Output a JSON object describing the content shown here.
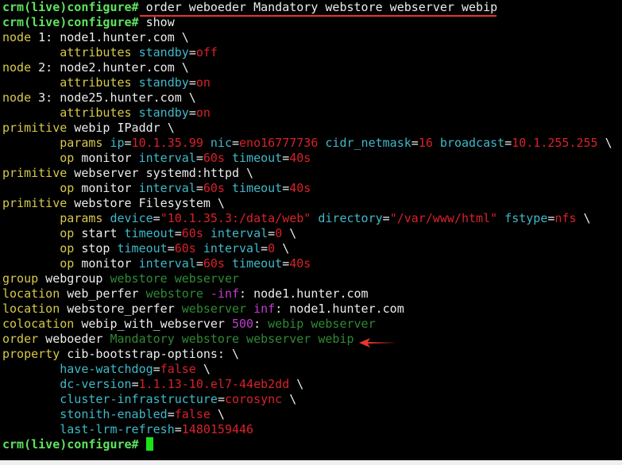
{
  "terminal": {
    "lines": [
      [
        {
          "t": "crm(live)configure# ",
          "c": "prompt"
        },
        {
          "t": "order weboeder Mandatory webstore webserver webip",
          "c": "cmd"
        }
      ],
      [
        {
          "t": "crm(live)configure# ",
          "c": "prompt"
        },
        {
          "t": "show",
          "c": "cmd"
        }
      ],
      [
        {
          "t": "node",
          "c": "kw"
        },
        {
          "t": " 1: node1.hunter.com \\",
          "c": "plain"
        }
      ],
      [
        {
          "t": "        ",
          "c": "plain"
        },
        {
          "t": "attributes",
          "c": "sub"
        },
        {
          "t": " ",
          "c": "plain"
        },
        {
          "t": "standby",
          "c": "attr"
        },
        {
          "t": "=",
          "c": "plain"
        },
        {
          "t": "off",
          "c": "val"
        }
      ],
      [
        {
          "t": "node",
          "c": "kw"
        },
        {
          "t": " 2: node2.hunter.com \\",
          "c": "plain"
        }
      ],
      [
        {
          "t": "        ",
          "c": "plain"
        },
        {
          "t": "attributes",
          "c": "sub"
        },
        {
          "t": " ",
          "c": "plain"
        },
        {
          "t": "standby",
          "c": "attr"
        },
        {
          "t": "=",
          "c": "plain"
        },
        {
          "t": "on",
          "c": "val"
        }
      ],
      [
        {
          "t": "node",
          "c": "kw"
        },
        {
          "t": " 3: node25.hunter.com \\",
          "c": "plain"
        }
      ],
      [
        {
          "t": "        ",
          "c": "plain"
        },
        {
          "t": "attributes",
          "c": "sub"
        },
        {
          "t": " ",
          "c": "plain"
        },
        {
          "t": "standby",
          "c": "attr"
        },
        {
          "t": "=",
          "c": "plain"
        },
        {
          "t": "on",
          "c": "val"
        }
      ],
      [
        {
          "t": "primitive",
          "c": "kw"
        },
        {
          "t": " webip IPaddr \\",
          "c": "plain"
        }
      ],
      [
        {
          "t": "        ",
          "c": "plain"
        },
        {
          "t": "params",
          "c": "sub"
        },
        {
          "t": " ",
          "c": "plain"
        },
        {
          "t": "ip",
          "c": "attr"
        },
        {
          "t": "=",
          "c": "plain"
        },
        {
          "t": "10.1.35.99",
          "c": "val"
        },
        {
          "t": " ",
          "c": "plain"
        },
        {
          "t": "nic",
          "c": "attr"
        },
        {
          "t": "=",
          "c": "plain"
        },
        {
          "t": "eno16777736",
          "c": "val"
        },
        {
          "t": " ",
          "c": "plain"
        },
        {
          "t": "cidr_netmask",
          "c": "attr"
        },
        {
          "t": "=",
          "c": "plain"
        },
        {
          "t": "16",
          "c": "val"
        },
        {
          "t": " ",
          "c": "plain"
        },
        {
          "t": "broadcast",
          "c": "attr"
        },
        {
          "t": "=",
          "c": "plain"
        },
        {
          "t": "10.1.255.255",
          "c": "val"
        },
        {
          "t": " \\",
          "c": "plain"
        }
      ],
      [
        {
          "t": "        ",
          "c": "plain"
        },
        {
          "t": "op",
          "c": "sub"
        },
        {
          "t": " monitor ",
          "c": "plain"
        },
        {
          "t": "interval",
          "c": "attr"
        },
        {
          "t": "=",
          "c": "plain"
        },
        {
          "t": "60s",
          "c": "val"
        },
        {
          "t": " ",
          "c": "plain"
        },
        {
          "t": "timeout",
          "c": "attr"
        },
        {
          "t": "=",
          "c": "plain"
        },
        {
          "t": "40s",
          "c": "val"
        }
      ],
      [
        {
          "t": "primitive",
          "c": "kw"
        },
        {
          "t": " webserver systemd:httpd \\",
          "c": "plain"
        }
      ],
      [
        {
          "t": "        ",
          "c": "plain"
        },
        {
          "t": "op",
          "c": "sub"
        },
        {
          "t": " monitor ",
          "c": "plain"
        },
        {
          "t": "interval",
          "c": "attr"
        },
        {
          "t": "=",
          "c": "plain"
        },
        {
          "t": "60s",
          "c": "val"
        },
        {
          "t": " ",
          "c": "plain"
        },
        {
          "t": "timeout",
          "c": "attr"
        },
        {
          "t": "=",
          "c": "plain"
        },
        {
          "t": "40s",
          "c": "val"
        }
      ],
      [
        {
          "t": "primitive",
          "c": "kw"
        },
        {
          "t": " webstore Filesystem \\",
          "c": "plain"
        }
      ],
      [
        {
          "t": "        ",
          "c": "plain"
        },
        {
          "t": "params",
          "c": "sub"
        },
        {
          "t": " ",
          "c": "plain"
        },
        {
          "t": "device",
          "c": "attr"
        },
        {
          "t": "=",
          "c": "plain"
        },
        {
          "t": "\"10.1.35.3:/data/web\"",
          "c": "val"
        },
        {
          "t": " ",
          "c": "plain"
        },
        {
          "t": "directory",
          "c": "attr"
        },
        {
          "t": "=",
          "c": "plain"
        },
        {
          "t": "\"/var/www/html\"",
          "c": "val"
        },
        {
          "t": " ",
          "c": "plain"
        },
        {
          "t": "fstype",
          "c": "attr"
        },
        {
          "t": "=",
          "c": "plain"
        },
        {
          "t": "nfs",
          "c": "val"
        },
        {
          "t": " \\",
          "c": "plain"
        }
      ],
      [
        {
          "t": "        ",
          "c": "plain"
        },
        {
          "t": "op",
          "c": "sub"
        },
        {
          "t": " start ",
          "c": "plain"
        },
        {
          "t": "timeout",
          "c": "attr"
        },
        {
          "t": "=",
          "c": "plain"
        },
        {
          "t": "60s",
          "c": "val"
        },
        {
          "t": " ",
          "c": "plain"
        },
        {
          "t": "interval",
          "c": "attr"
        },
        {
          "t": "=",
          "c": "plain"
        },
        {
          "t": "0",
          "c": "val"
        },
        {
          "t": " \\",
          "c": "plain"
        }
      ],
      [
        {
          "t": "        ",
          "c": "plain"
        },
        {
          "t": "op",
          "c": "sub"
        },
        {
          "t": " stop ",
          "c": "plain"
        },
        {
          "t": "timeout",
          "c": "attr"
        },
        {
          "t": "=",
          "c": "plain"
        },
        {
          "t": "60s",
          "c": "val"
        },
        {
          "t": " ",
          "c": "plain"
        },
        {
          "t": "interval",
          "c": "attr"
        },
        {
          "t": "=",
          "c": "plain"
        },
        {
          "t": "0",
          "c": "val"
        },
        {
          "t": " \\",
          "c": "plain"
        }
      ],
      [
        {
          "t": "        ",
          "c": "plain"
        },
        {
          "t": "op",
          "c": "sub"
        },
        {
          "t": " monitor ",
          "c": "plain"
        },
        {
          "t": "interval",
          "c": "attr"
        },
        {
          "t": "=",
          "c": "plain"
        },
        {
          "t": "60s",
          "c": "val"
        },
        {
          "t": " ",
          "c": "plain"
        },
        {
          "t": "timeout",
          "c": "attr"
        },
        {
          "t": "=",
          "c": "plain"
        },
        {
          "t": "40s",
          "c": "val"
        }
      ],
      [
        {
          "t": "group",
          "c": "kw"
        },
        {
          "t": " webgroup ",
          "c": "plain"
        },
        {
          "t": "webstore webserver",
          "c": "ref"
        }
      ],
      [
        {
          "t": "location",
          "c": "kw"
        },
        {
          "t": " web_perfer ",
          "c": "plain"
        },
        {
          "t": "webstore",
          "c": "ref"
        },
        {
          "t": " ",
          "c": "plain"
        },
        {
          "t": "-inf",
          "c": "score"
        },
        {
          "t": ": node1.hunter.com",
          "c": "plain"
        }
      ],
      [
        {
          "t": "location",
          "c": "kw"
        },
        {
          "t": " webstore_perfer ",
          "c": "plain"
        },
        {
          "t": "webserver",
          "c": "ref"
        },
        {
          "t": " ",
          "c": "plain"
        },
        {
          "t": "inf",
          "c": "score"
        },
        {
          "t": ": node1.hunter.com",
          "c": "plain"
        }
      ],
      [
        {
          "t": "colocation",
          "c": "kw"
        },
        {
          "t": " webip_with_webserver ",
          "c": "plain"
        },
        {
          "t": "500",
          "c": "score"
        },
        {
          "t": ": ",
          "c": "plain"
        },
        {
          "t": "webip webserver",
          "c": "ref"
        }
      ],
      [
        {
          "t": "order",
          "c": "kw"
        },
        {
          "t": " weboeder ",
          "c": "plain"
        },
        {
          "t": "Mandatory webstore webserver webip",
          "c": "ref"
        }
      ],
      [
        {
          "t": "property",
          "c": "kw"
        },
        {
          "t": " cib-bootstrap-options: \\",
          "c": "plain"
        }
      ],
      [
        {
          "t": "        ",
          "c": "plain"
        },
        {
          "t": "have-watchdog",
          "c": "attr"
        },
        {
          "t": "=",
          "c": "plain"
        },
        {
          "t": "false",
          "c": "val"
        },
        {
          "t": " \\",
          "c": "plain"
        }
      ],
      [
        {
          "t": "        ",
          "c": "plain"
        },
        {
          "t": "dc-version",
          "c": "attr"
        },
        {
          "t": "=",
          "c": "plain"
        },
        {
          "t": "1.1.13-10.el7-44eb2dd",
          "c": "val"
        },
        {
          "t": " \\",
          "c": "plain"
        }
      ],
      [
        {
          "t": "        ",
          "c": "plain"
        },
        {
          "t": "cluster-infrastructure",
          "c": "attr"
        },
        {
          "t": "=",
          "c": "plain"
        },
        {
          "t": "corosync",
          "c": "val"
        },
        {
          "t": " \\",
          "c": "plain"
        }
      ],
      [
        {
          "t": "        ",
          "c": "plain"
        },
        {
          "t": "stonith-enabled",
          "c": "attr"
        },
        {
          "t": "=",
          "c": "plain"
        },
        {
          "t": "false",
          "c": "val"
        },
        {
          "t": " \\",
          "c": "plain"
        }
      ],
      [
        {
          "t": "        ",
          "c": "plain"
        },
        {
          "t": "last-lrm-refresh",
          "c": "attr"
        },
        {
          "t": "=",
          "c": "plain"
        },
        {
          "t": "1480159446",
          "c": "val"
        }
      ],
      [
        {
          "t": "crm(live)configure# ",
          "c": "prompt"
        }
      ]
    ]
  },
  "annotations": {
    "underline_color": "#e8352b",
    "arrow_color": "#e8352b",
    "arrow_icon": "left-arrow-icon"
  }
}
